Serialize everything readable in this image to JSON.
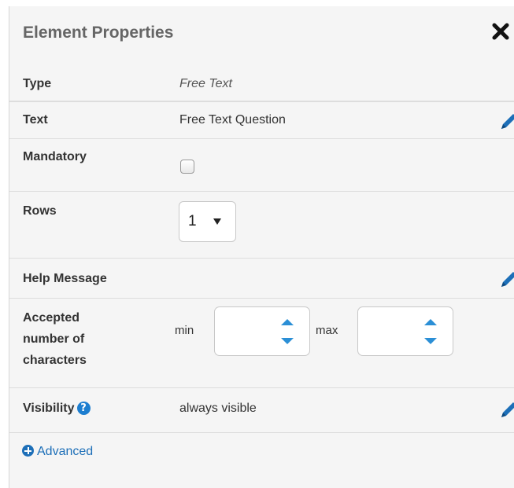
{
  "panel": {
    "title": "Element Properties",
    "close_icon": "close-icon"
  },
  "rows": {
    "type": {
      "label": "Type",
      "value": "Free Text"
    },
    "text": {
      "label": "Text",
      "value": "Free Text Question",
      "edit_icon": "pencil-icon"
    },
    "mandatory": {
      "label": "Mandatory",
      "checked": false
    },
    "rows": {
      "label": "Rows",
      "selected": "1"
    },
    "help": {
      "label": "Help Message",
      "edit_icon": "pencil-icon"
    },
    "accepted": {
      "label_line1": "Accepted",
      "label_line2": "number of",
      "label_line3": "characters",
      "min_label": "min",
      "max_label": "max",
      "min_value": "",
      "max_value": ""
    },
    "visibility": {
      "label": "Visibility",
      "help_icon": "question-circle-icon",
      "value": "always visible",
      "edit_icon": "pencil-icon"
    }
  },
  "footer": {
    "advanced_label": "Advanced",
    "advanced_icon": "plus-circle-icon"
  },
  "colors": {
    "panel_bg": "#f5f5f5",
    "accent_blue": "#1d6fb8",
    "spinner_blue": "#2b8fd6",
    "divider": "#dddddd"
  }
}
